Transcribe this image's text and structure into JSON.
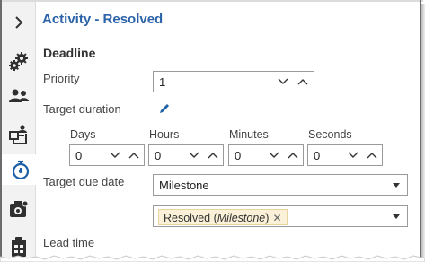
{
  "panel": {
    "title_prefix": "Activity",
    "title_suffix": " - Resolved",
    "collapse_icon": "chevron-right-icon"
  },
  "sidebar": {
    "items": [
      {
        "icon": "gears-icon"
      },
      {
        "icon": "users-icon"
      },
      {
        "icon": "org-chart-icon"
      },
      {
        "icon": "stopwatch-icon",
        "active": true
      },
      {
        "icon": "camera-badge-icon"
      },
      {
        "icon": "checklist-icon"
      }
    ]
  },
  "deadline": {
    "section_title": "Deadline",
    "priority": {
      "label": "Priority",
      "value": "1"
    },
    "target_duration": {
      "label": "Target duration",
      "edit_icon": "pencil-icon",
      "days": {
        "label": "Days",
        "value": "0"
      },
      "hours": {
        "label": "Hours",
        "value": "0"
      },
      "minutes": {
        "label": "Minutes",
        "value": "0"
      },
      "seconds": {
        "label": "Seconds",
        "value": "0"
      }
    },
    "target_due_date": {
      "label": "Target due date",
      "value": "Milestone",
      "milestone_tag": {
        "name": "Resolved",
        "kind": "Milestone"
      }
    },
    "lead_time": {
      "label": "Lead time"
    }
  },
  "colors": {
    "title": "#2b62a8",
    "sidebar_bg": "#f2f2f2",
    "tag_bg": "#fbf1d8",
    "icon": "#2f2f2f"
  }
}
